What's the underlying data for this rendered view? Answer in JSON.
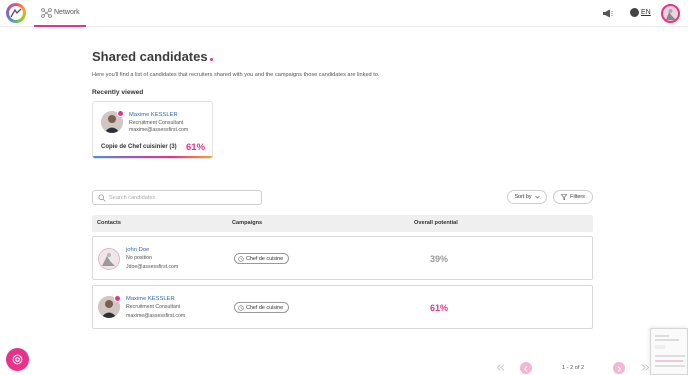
{
  "nav": {
    "network_label": "Network"
  },
  "header": {
    "lang": "EN"
  },
  "page": {
    "title": "Shared candidates",
    "description": "Here you'll find a list of candidates that recruiters shared with you and the campaigns those candidates are linked to."
  },
  "recent": {
    "heading": "Recently viewed",
    "card": {
      "name": "Maxime KESSLER",
      "role": "Recruitment Consultant",
      "email": "maxime@assessfirst.com",
      "campaign": "Copie de Chef cuisinier (3)",
      "percent": "61%"
    }
  },
  "controls": {
    "search_placeholder": "Search candidates",
    "sort_label": "Sort by",
    "filters_label": "Filters"
  },
  "table": {
    "headers": [
      "Contacts",
      "Campaigns",
      "Overall potential"
    ],
    "rows": [
      {
        "name": "john Doe",
        "position": "No position",
        "email": "Jdoe@assessfirst.com",
        "campaign": "Chef de cuisine",
        "potential": "39%"
      },
      {
        "name": "Maxime KESSLER",
        "position": "Recruitment Consultant",
        "email": "maxime@assessfirst.com",
        "campaign": "Chef de cuisine",
        "potential": "61%"
      }
    ]
  },
  "pagination": {
    "info": "1 - 2 of 2"
  },
  "colors": {
    "accent": "#e8318a",
    "link": "#2b6cb0",
    "muted_percent": "#9a9a9a"
  }
}
